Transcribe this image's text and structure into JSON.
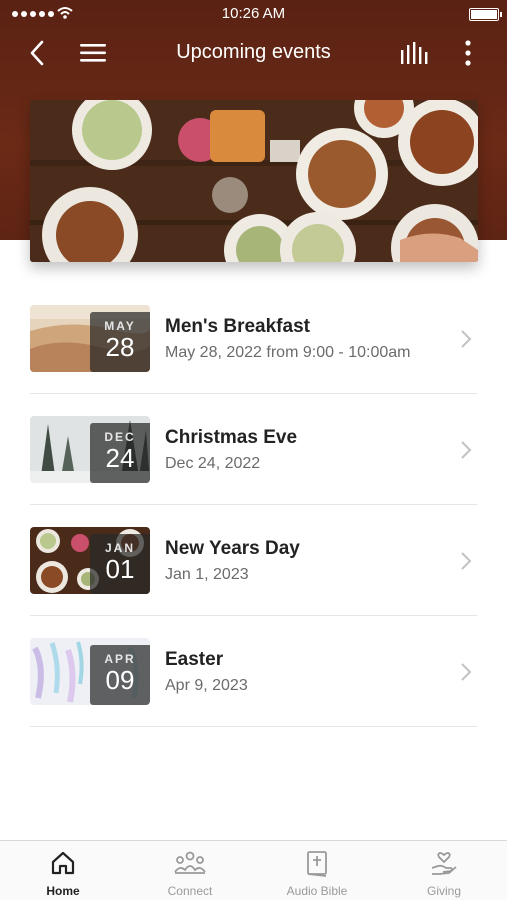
{
  "status": {
    "time": "10:26 AM"
  },
  "nav": {
    "title": "Upcoming events"
  },
  "events": [
    {
      "month": "MAY",
      "day": "28",
      "title": "Men's Breakfast",
      "subtitle": "May 28, 2022 from 9:00 - 10:00am",
      "thumb": "desert"
    },
    {
      "month": "DEC",
      "day": "24",
      "title": "Christmas Eve",
      "subtitle": "Dec 24, 2022",
      "thumb": "snow-forest"
    },
    {
      "month": "JAN",
      "day": "01",
      "title": "New Years Day",
      "subtitle": "Jan 1, 2023",
      "thumb": "food"
    },
    {
      "month": "APR",
      "day": "09",
      "title": "Easter",
      "subtitle": "Apr 9, 2023",
      "thumb": "pastel-paint"
    }
  ],
  "tabs": [
    {
      "label": "Home",
      "icon": "home-icon",
      "active": true
    },
    {
      "label": "Connect",
      "icon": "people-icon",
      "active": false
    },
    {
      "label": "Audio Bible",
      "icon": "bible-icon",
      "active": false
    },
    {
      "label": "Giving",
      "icon": "giving-hand-icon",
      "active": false
    }
  ],
  "colors": {
    "header": "#5e2414",
    "active_tab": "#222222",
    "inactive_tab": "#9a9a9a"
  }
}
